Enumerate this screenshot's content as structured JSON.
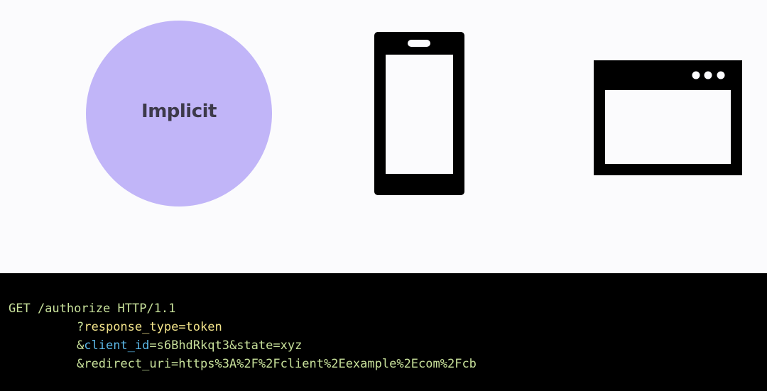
{
  "diagram": {
    "flow_label": "Implicit",
    "colors": {
      "circle_fill": "#c1b5f8",
      "circle_text": "#3d3a4a",
      "icon_fill": "#000000",
      "code_background": "#000000",
      "code_green": "#c7e09a",
      "code_yellow": "#f2e38a",
      "code_blue": "#5bb8e8"
    },
    "icons": [
      "mobile-phone-icon",
      "browser-window-icon"
    ]
  },
  "code": {
    "line1": "GET /authorize HTTP/1.1",
    "line2_prefix": "?",
    "line2_param": "response_type",
    "line2_rest": "=token",
    "line3_prefix": "&",
    "line3_param": "client_id",
    "line3_rest": "=s6BhdRkqt3&state=xyz",
    "line4": "&redirect_uri=https%3A%2F%2Fclient%2Eexample%2Ecom%2Fcb"
  }
}
